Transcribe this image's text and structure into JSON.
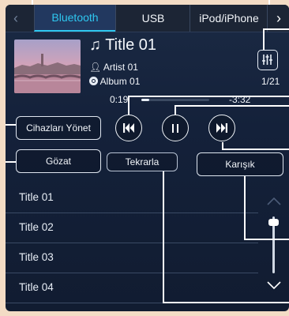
{
  "tabs": {
    "items": [
      {
        "label": "Bluetooth",
        "active": true
      },
      {
        "label": "USB",
        "active": false
      },
      {
        "label": "iPod/iPhone",
        "active": false
      }
    ]
  },
  "track": {
    "title": "Title 01",
    "artist": "Artist 01",
    "album": "Album 01",
    "index": "1/21",
    "elapsed": "0:19",
    "remaining": "-3:32",
    "progress": 0.12
  },
  "buttons": {
    "manage_devices": "Cihazları Yönet",
    "browse": "Gözat",
    "repeat": "Tekrarla",
    "shuffle": "Karışık"
  },
  "list": {
    "items": [
      "Title 01",
      "Title 02",
      "Title 03",
      "Title 04"
    ],
    "scroll_position": 0.05
  },
  "colors": {
    "accent": "#2ec7f0",
    "background": "#14213a",
    "page": "#f3dcc5"
  },
  "icons": {
    "note": "music-note-icon",
    "artist": "person-icon",
    "album": "disc-icon",
    "eq": "equalizer-icon",
    "prev": "skip-previous-icon",
    "pause": "pause-icon",
    "next": "skip-next-icon"
  }
}
